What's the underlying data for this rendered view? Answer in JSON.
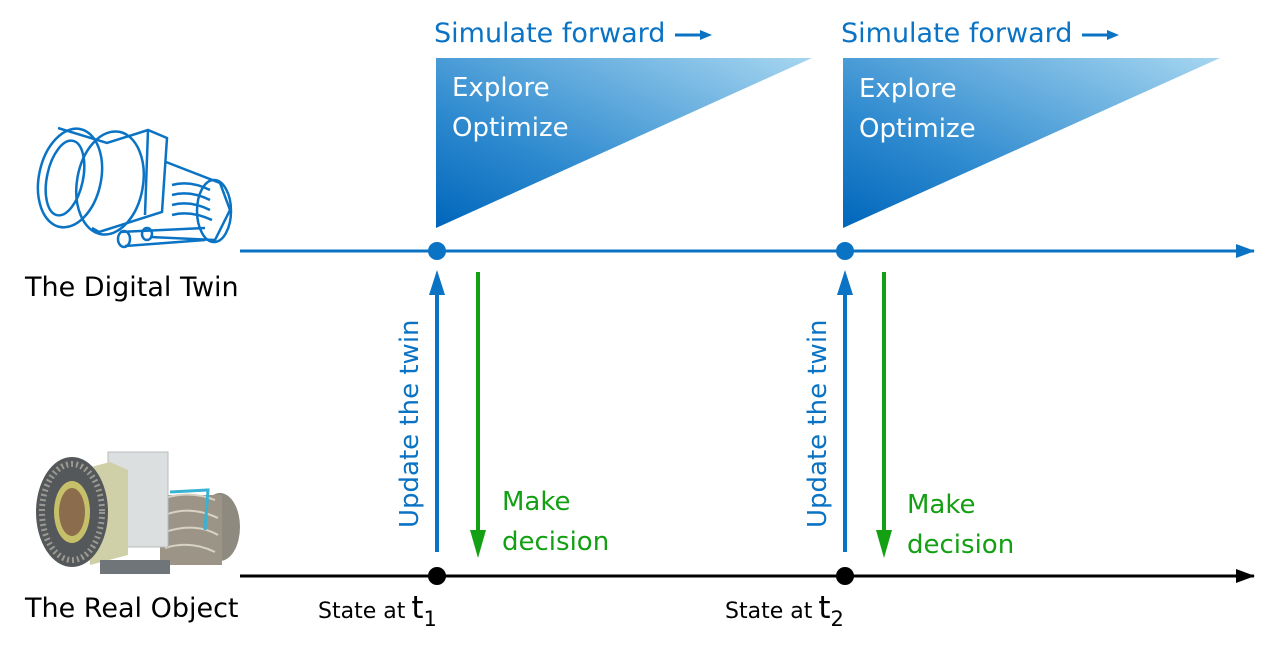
{
  "colors": {
    "digital": "#0A73C4",
    "decision": "#13A013",
    "real": "#000000",
    "triangle_dark": "#0066BB",
    "triangle_light": "#92CBEB"
  },
  "rows": {
    "digital_twin_label": "The Digital Twin",
    "real_object_label": "The Real Object",
    "digital_twin_icon": "engine-wireframe-icon",
    "real_object_image": "gas-turbine-engine-photo"
  },
  "stages": [
    {
      "simulate_label": "Simulate forward",
      "explore_label": "Explore",
      "optimize_label": "Optimize",
      "update_label": "Update the twin",
      "make_label": "Make",
      "decision_label": "decision",
      "state_label": "State at",
      "time_symbol": "t",
      "time_subscript": "1"
    },
    {
      "simulate_label": "Simulate forward",
      "explore_label": "Explore",
      "optimize_label": "Optimize",
      "update_label": "Update the twin",
      "make_label": "Make",
      "decision_label": "decision",
      "state_label": "State at",
      "time_symbol": "t",
      "time_subscript": "2"
    }
  ]
}
